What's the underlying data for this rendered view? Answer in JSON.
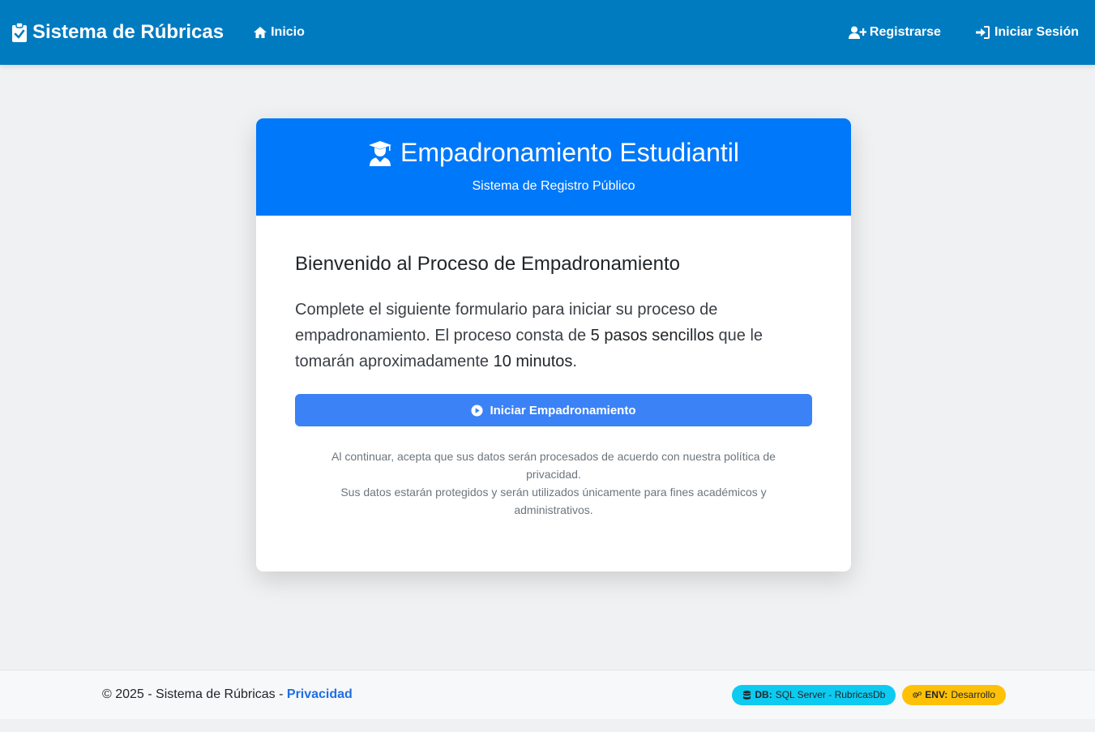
{
  "navbar": {
    "brand": "Sistema de Rúbricas",
    "home_label": "Inicio",
    "register_label": "Registrarse",
    "login_label": "Iniciar Sesión",
    "background_color": "#007bc0"
  },
  "card": {
    "title": "Empadronamiento Estudiantil",
    "subtitle": "Sistema de Registro Público",
    "header_color": "#0078fa",
    "welcome_title": "Bienvenido al Proceso de Empadronamiento",
    "intro_part1": "Complete el siguiente formulario para iniciar su proceso de empadronamiento. El proceso consta de ",
    "intro_steps": "5 pasos sencillos",
    "intro_part2": " que le tomarán aproximadamente ",
    "intro_time": "10 minutos",
    "intro_part3": ".",
    "start_button": "Iniciar Empadronamiento",
    "legal_line1": "Al continuar, acepta que sus datos serán procesados de acuerdo con nuestra política de privacidad.",
    "legal_line2": "Sus datos estarán protegidos y serán utilizados únicamente para fines académicos y administrativos."
  },
  "footer": {
    "copyright": "© 2025 - Sistema de Rúbricas - ",
    "privacy_link": "Privacidad",
    "db_label": "DB:",
    "db_value": "SQL Server - RubricasDb",
    "env_label": "ENV:",
    "env_value": "Desarrollo"
  },
  "icons": {
    "brand": "clipboard-check-icon",
    "home": "home-icon",
    "register": "user-plus-icon",
    "login": "sign-in-icon",
    "title": "graduate-icon",
    "start": "play-circle-icon",
    "db": "database-icon",
    "env": "gears-icon"
  }
}
